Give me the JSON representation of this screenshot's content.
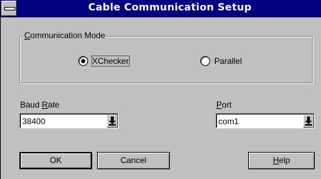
{
  "window": {
    "title": "Cable Communication Setup",
    "system_menu_icon": "system-menu-bar"
  },
  "communication_mode": {
    "group_label_accel": "C",
    "group_label_rest": "ommunication Mode",
    "options": [
      {
        "label": "XChecker",
        "selected": true
      },
      {
        "label": "Parallel",
        "selected": false
      }
    ]
  },
  "baud_rate": {
    "label_pre": "Baud ",
    "label_accel": "R",
    "label_post": "ate",
    "value": "38400"
  },
  "port": {
    "label_accel": "P",
    "label_post": "ort",
    "value": "com1"
  },
  "buttons": {
    "ok": "OK",
    "cancel": "Cancel",
    "help_accel": "H",
    "help_rest": "elp"
  },
  "icons": {
    "dropdown": "arrow-down-to-line-icon"
  }
}
